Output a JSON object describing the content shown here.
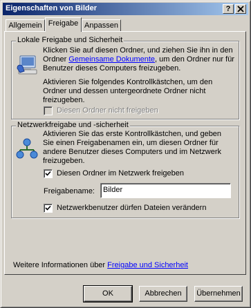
{
  "window": {
    "title": "Eigenschaften von Bilder",
    "help_button": "?",
    "close_button": "X"
  },
  "tabs": [
    {
      "label": "Allgemein",
      "active": false
    },
    {
      "label": "Freigabe",
      "active": true
    },
    {
      "label": "Anpassen",
      "active": false
    }
  ],
  "local_group": {
    "legend": "Lokale Freigabe und Sicherheit",
    "text1_part1": "Klicken Sie auf diesen Ordner, und ziehen Sie ihn in den",
    "text1_part2a": "Ordner ",
    "text1_link": "Gemeinsame Dokumente",
    "text1_part2b": ", um den Ordner nur für",
    "text1_part3": "Benutzer dieses Computers freizugeben.",
    "text2_line1": "Aktivieren Sie folgendes Kontrollkästchen, um den",
    "text2_line2": "Ordner und dessen untergeordnete Ordner nicht",
    "text2_line3": "freizugeben.",
    "checkbox_label": "Diesen Ordner nicht freigeben",
    "checkbox_checked": false,
    "checkbox_disabled": true
  },
  "network_group": {
    "legend": "Netzwerkfreigabe und -sicherheit",
    "text_line1": "Aktivieren Sie das erste Kontrollkästchen, und geben",
    "text_line2": "Sie einen Freigabenamen ein, um diesen Ordner für",
    "text_line3": "andere Benutzer dieses Computers und im Netzwerk",
    "text_line4": "freizugeben.",
    "share_checkbox_label": "Diesen Ordner im Netzwerk freigeben",
    "share_checked": true,
    "share_name_label": "Freigabename:",
    "share_name_value": "Bilder",
    "modify_checkbox_label": "Netzwerkbenutzer dürfen Dateien verändern",
    "modify_checked": true
  },
  "footer": {
    "info_text": "Weitere Informationen über ",
    "info_link": "Freigabe und Sicherheit"
  },
  "buttons": {
    "ok": "OK",
    "cancel": "Abbrechen",
    "apply": "Übernehmen"
  }
}
